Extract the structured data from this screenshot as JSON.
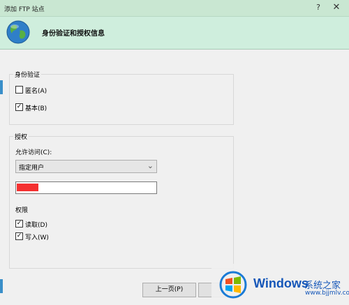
{
  "window": {
    "title": "添加 FTP 站点",
    "help_glyph": "?",
    "close_glyph": "✕"
  },
  "header": {
    "title": "身份验证和授权信息",
    "icon": "globe-icon"
  },
  "authentication": {
    "label": "身份验证",
    "anonymous": {
      "label": "匿名(A)",
      "checked": false
    },
    "basic": {
      "label": "基本(B)",
      "checked": true
    }
  },
  "authorization": {
    "label": "授权",
    "allow_access_label": "允许访问(C):",
    "allow_access_selected": "指定用户",
    "user_value": "",
    "permissions_label": "权限",
    "read": {
      "label": "读取(D)",
      "checked": true
    },
    "write": {
      "label": "写入(W)",
      "checked": true
    }
  },
  "footer": {
    "prev_label": "上一页(P)"
  },
  "watermark": {
    "brand": "Windows",
    "cn": "系统之家",
    "url": "www.bjjmlv.com",
    "icon": "windows-logo-icon"
  },
  "colors": {
    "title_bg": "#c9e7d2",
    "header_bg": "#cfeedd",
    "accent": "#1456b8",
    "redaction": "#f43030"
  }
}
